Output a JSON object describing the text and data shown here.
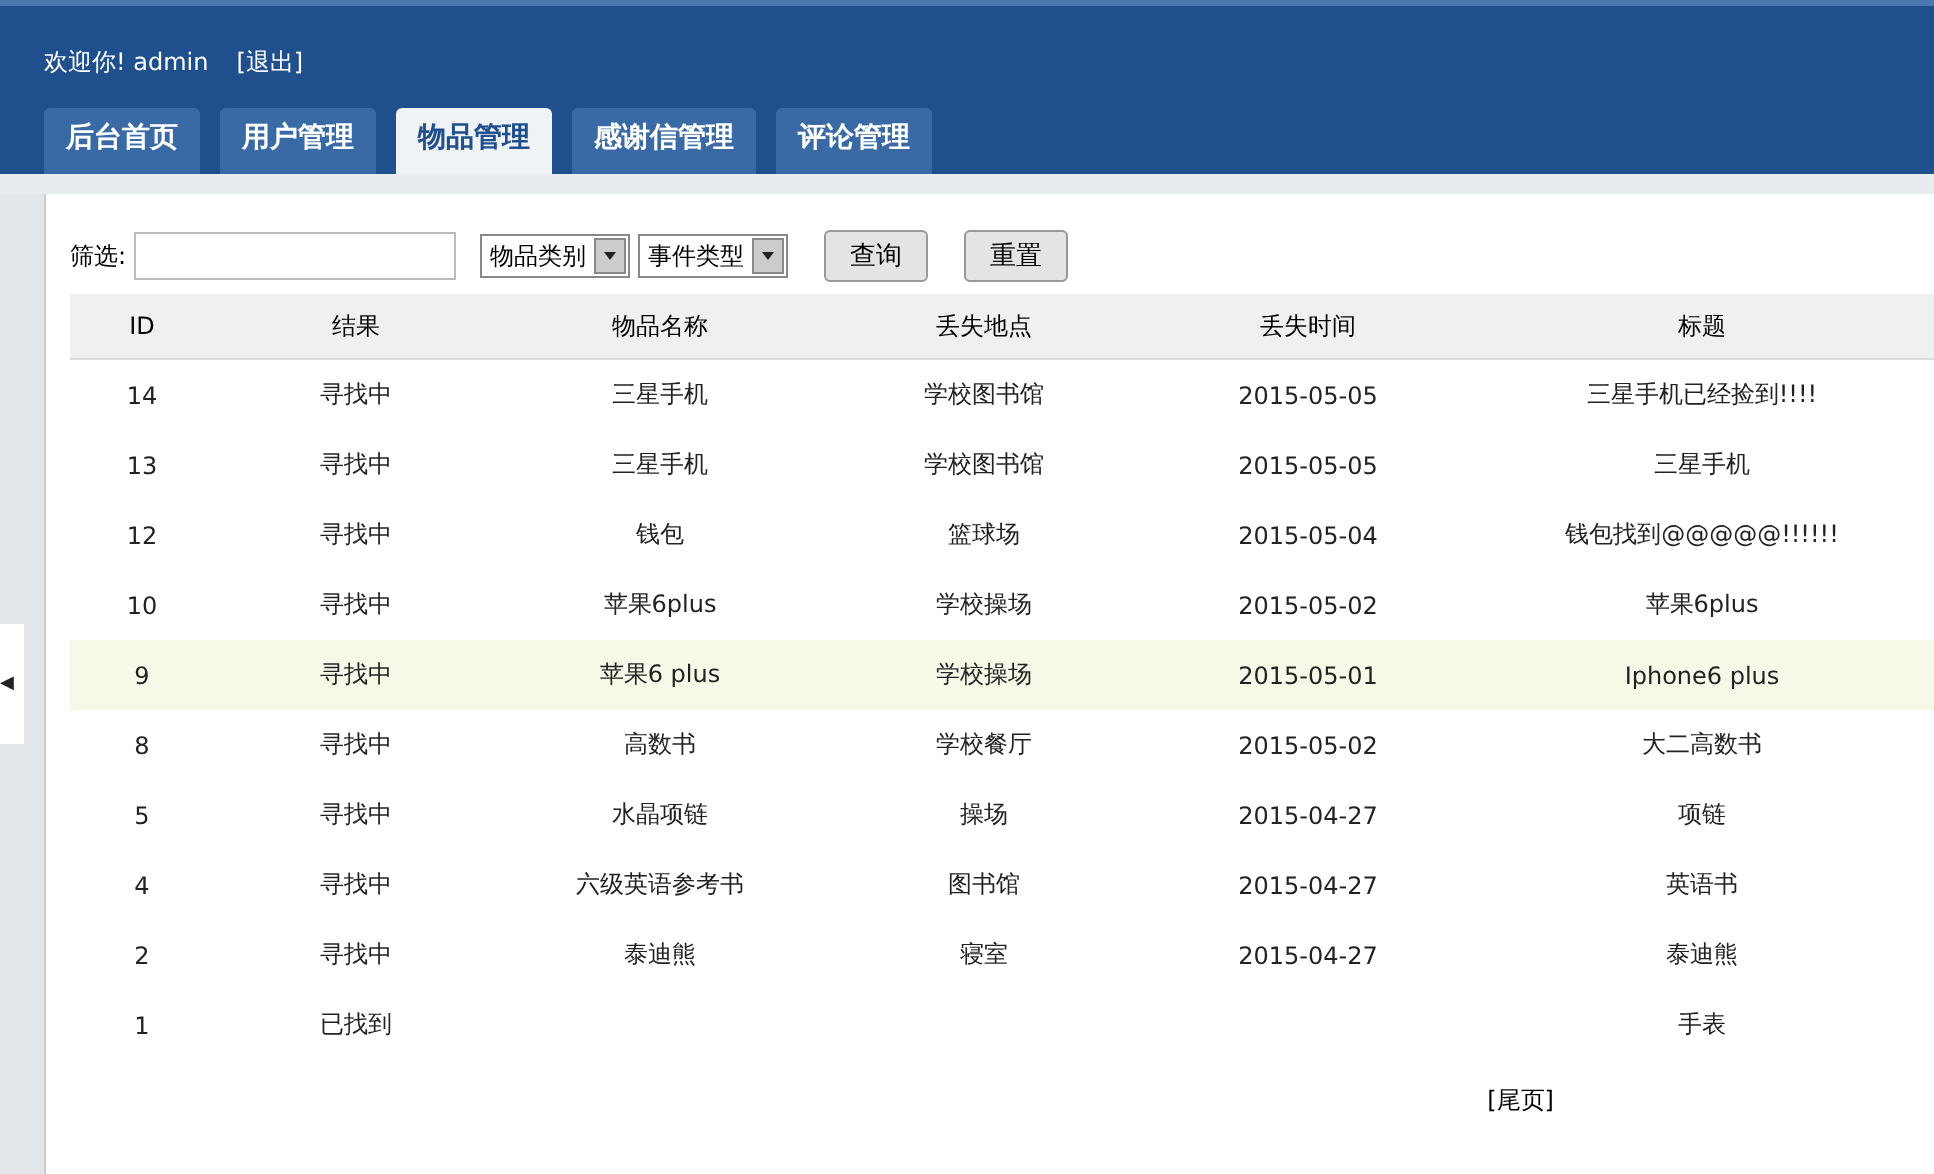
{
  "header": {
    "welcome": "欢迎你! admin",
    "logout": "[退出]"
  },
  "tabs": [
    {
      "label": "后台首页",
      "selected": false
    },
    {
      "label": "用户管理",
      "selected": false
    },
    {
      "label": "物品管理",
      "selected": true
    },
    {
      "label": "感谢信管理",
      "selected": false
    },
    {
      "label": "评论管理",
      "selected": false
    }
  ],
  "sidebar": {
    "toggle": "◀"
  },
  "filter": {
    "label": "筛选:",
    "category": "物品类别",
    "event_type": "事件类型",
    "buttons": [
      "查询",
      "重置"
    ]
  },
  "table": {
    "columns": [
      "ID",
      "结果",
      "物品名称",
      "丢失地点",
      "丢失时间",
      "标题"
    ],
    "rows": [
      {
        "cells": [
          "14",
          "寻找中",
          "三星手机",
          "学校图书馆",
          "2015-05-05",
          "三星手机已经捡到!!!!"
        ],
        "selected": false
      },
      {
        "cells": [
          "13",
          "寻找中",
          "三星手机",
          "学校图书馆",
          "2015-05-05",
          "三星手机"
        ],
        "selected": false
      },
      {
        "cells": [
          "12",
          "寻找中",
          "钱包",
          "篮球场",
          "2015-05-04",
          "钱包找到@@@@@!!!!!!"
        ],
        "selected": false
      },
      {
        "cells": [
          "10",
          "寻找中",
          "苹果6plus",
          "学校操场",
          "2015-05-02",
          "苹果6plus"
        ],
        "selected": false
      },
      {
        "cells": [
          "9",
          "寻找中",
          "苹果6 plus",
          "学校操场",
          "2015-05-01",
          "Iphone6 plus"
        ],
        "selected": true
      },
      {
        "cells": [
          "8",
          "寻找中",
          "高数书",
          "学校餐厅",
          "2015-05-02",
          "大二高数书"
        ],
        "selected": false
      },
      {
        "cells": [
          "5",
          "寻找中",
          "水晶项链",
          "操场",
          "2015-04-27",
          "项链"
        ],
        "selected": false
      },
      {
        "cells": [
          "4",
          "寻找中",
          "六级英语参考书",
          "图书馆",
          "2015-04-27",
          "英语书"
        ],
        "selected": false
      },
      {
        "cells": [
          "2",
          "寻找中",
          "泰迪熊",
          "寝室",
          "2015-04-27",
          "泰迪熊"
        ],
        "selected": false
      },
      {
        "cells": [
          "1",
          "已找到",
          "",
          "",
          "",
          "手表"
        ],
        "selected": false
      }
    ]
  },
  "pagination": {
    "last": "[尾页]"
  }
}
